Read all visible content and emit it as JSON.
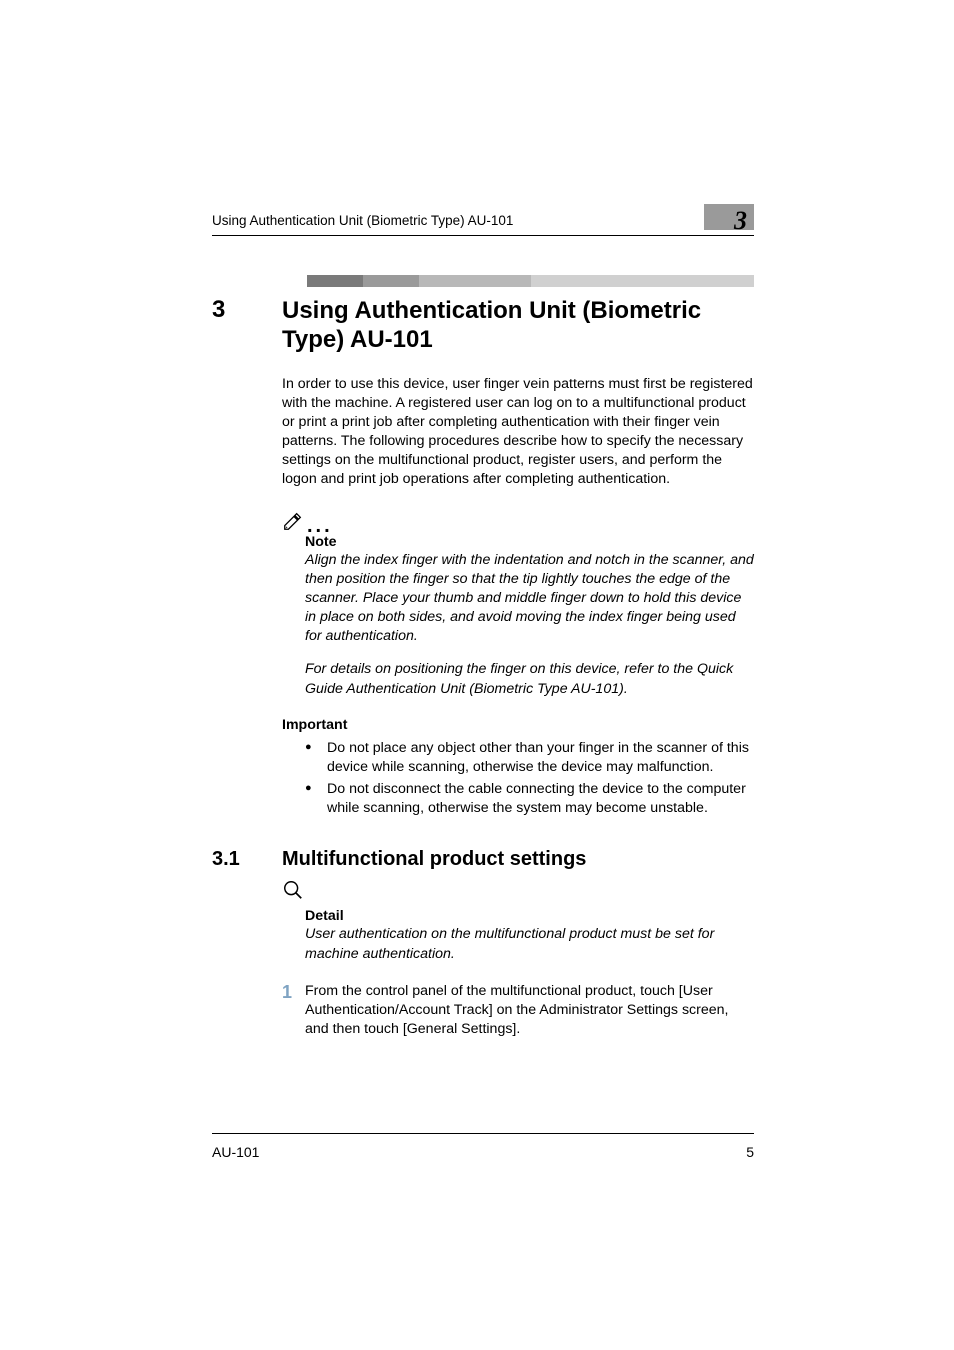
{
  "header": {
    "running_title": "Using Authentication Unit (Biometric Type) AU-101",
    "chapter_badge": "3"
  },
  "title": {
    "num": "3",
    "text": "Using Authentication Unit (Biometric Type) AU-101"
  },
  "intro": "In order to use this device, user finger vein patterns must first be registered with the machine. A registered user can log on to a multifunctional product or print a print job after completing authentication with their finger vein patterns. The following procedures describe how to specify the necessary settings on the multifunctional product, register users, and perform the logon and print job operations after completing authentication.",
  "note": {
    "heading": "Note",
    "p1": "Align the index finger with the indentation and notch in the scanner, and then position the finger so that the tip lightly touches the edge of the scanner. Place your thumb and middle finger down to hold this device in place on both sides, and avoid moving the index finger being used for authentication.",
    "p2": "For details on positioning the finger on this device, refer to the Quick Guide Authentication Unit (Biometric Type AU-101)."
  },
  "important": {
    "heading": "Important",
    "items": [
      "Do not place any object other than your finger in the scanner of this device while scanning, otherwise the device may malfunction.",
      "Do not disconnect the cable connecting the device to the computer while scanning, otherwise the system may become unstable."
    ]
  },
  "section": {
    "num": "3.1",
    "text": "Multifunctional product settings"
  },
  "detail": {
    "heading": "Detail",
    "body": "User authentication on the multifunctional product must be set for machine authentication."
  },
  "step1": {
    "num": "1",
    "text": "From the control panel of the multifunctional product, touch [User Authentication/Account Track] on the Administrator Settings screen, and then touch [General Settings]."
  },
  "footer": {
    "model": "AU-101",
    "page": "5"
  }
}
